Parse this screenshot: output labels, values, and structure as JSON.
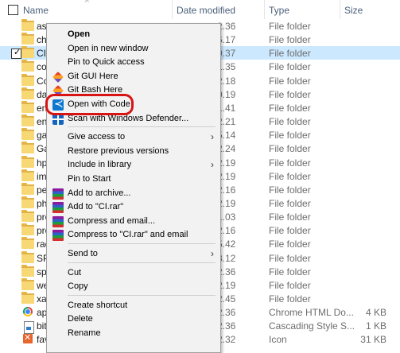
{
  "header": {
    "name": "Name",
    "date_modified": "Date modified",
    "type": "Type",
    "size": "Size"
  },
  "files": [
    {
      "name": "ass",
      "date": "2.36",
      "type": "File folder",
      "size": "",
      "icon": "folder-icon",
      "selected": false
    },
    {
      "name": "cha",
      "date": "6.17",
      "type": "File folder",
      "size": "",
      "icon": "folder-icon",
      "selected": false
    },
    {
      "name": "CI",
      "date": "9.37",
      "type": "File folder",
      "size": "",
      "icon": "folder-icon",
      "selected": true
    },
    {
      "name": "cob",
      "date": "1.35",
      "type": "File folder",
      "size": "",
      "icon": "folder-icon",
      "selected": false
    },
    {
      "name": "Cob",
      "date": "2.18",
      "type": "File folder",
      "size": "",
      "icon": "folder-icon",
      "selected": false
    },
    {
      "name": "das",
      "date": "0.19",
      "type": "File folder",
      "size": "",
      "icon": "folder-icon",
      "selected": false
    },
    {
      "name": "enk",
      "date": "1.41",
      "type": "File folder",
      "size": "",
      "icon": "folder-icon",
      "selected": false
    },
    {
      "name": "ent",
      "date": "2.21",
      "type": "File folder",
      "size": "",
      "icon": "folder-icon",
      "selected": false
    },
    {
      "name": "gar",
      "date": "5.14",
      "type": "File folder",
      "size": "",
      "icon": "folder-icon",
      "selected": false
    },
    {
      "name": "Gar",
      "date": "2.24",
      "type": "File folder",
      "size": "",
      "icon": "folder-icon",
      "selected": false
    },
    {
      "name": "hph",
      "date": "2.19",
      "type": "File folder",
      "size": "",
      "icon": "folder-icon",
      "selected": false
    },
    {
      "name": "img",
      "date": "2.19",
      "type": "File folder",
      "size": "",
      "icon": "folder-icon",
      "selected": false
    },
    {
      "name": "pel",
      "date": "2.16",
      "type": "File folder",
      "size": "",
      "icon": "folder-icon",
      "selected": false
    },
    {
      "name": "php",
      "date": "2.19",
      "type": "File folder",
      "size": "",
      "icon": "folder-icon",
      "selected": false
    },
    {
      "name": "pro",
      "date": "1.03",
      "type": "File folder",
      "size": "",
      "icon": "folder-icon",
      "selected": false
    },
    {
      "name": "pro",
      "date": "2.16",
      "type": "File folder",
      "size": "",
      "icon": "folder-icon",
      "selected": false
    },
    {
      "name": "rac",
      "date": "5.42",
      "type": "File folder",
      "size": "",
      "icon": "folder-icon",
      "selected": false
    },
    {
      "name": "SPK",
      "date": "3.12",
      "type": "File folder",
      "size": "",
      "icon": "folder-icon",
      "selected": false
    },
    {
      "name": "spk",
      "date": "2.36",
      "type": "File folder",
      "size": "",
      "icon": "folder-icon",
      "selected": false
    },
    {
      "name": "wel",
      "date": "2.19",
      "type": "File folder",
      "size": "",
      "icon": "folder-icon",
      "selected": false
    },
    {
      "name": "xan",
      "date": "2.45",
      "type": "File folder",
      "size": "",
      "icon": "folder-icon",
      "selected": false
    },
    {
      "name": "app",
      "date": "2.36",
      "type": "Chrome HTML Do...",
      "size": "4 KB",
      "icon": "chrome-icon",
      "selected": false
    },
    {
      "name": "bitr",
      "date": "2.36",
      "type": "Cascading Style S...",
      "size": "1 KB",
      "icon": "css-file-icon",
      "selected": false
    },
    {
      "name": "favi",
      "date": "2.32",
      "type": "Icon",
      "size": "31 KB",
      "icon": "favicon-icon",
      "selected": false
    }
  ],
  "context_menu": {
    "items": [
      {
        "label": "Open",
        "bold": true,
        "icon": "",
        "submenu": false,
        "sep_before": false
      },
      {
        "label": "Open in new window",
        "bold": false,
        "icon": "",
        "submenu": false,
        "sep_before": false
      },
      {
        "label": "Pin to Quick access",
        "bold": false,
        "icon": "",
        "submenu": false,
        "sep_before": false
      },
      {
        "label": "Git GUI Here",
        "bold": false,
        "icon": "git-icon",
        "submenu": false,
        "sep_before": false
      },
      {
        "label": "Git Bash Here",
        "bold": false,
        "icon": "git-icon",
        "submenu": false,
        "sep_before": false
      },
      {
        "label": "Open with Code",
        "bold": false,
        "icon": "vscode-icon",
        "submenu": false,
        "sep_before": false
      },
      {
        "label": "Scan with Windows Defender...",
        "bold": false,
        "icon": "defender-icon",
        "submenu": false,
        "sep_before": false
      },
      {
        "label": "Give access to",
        "bold": false,
        "icon": "",
        "submenu": true,
        "sep_before": true
      },
      {
        "label": "Restore previous versions",
        "bold": false,
        "icon": "",
        "submenu": false,
        "sep_before": false
      },
      {
        "label": "Include in library",
        "bold": false,
        "icon": "",
        "submenu": true,
        "sep_before": false
      },
      {
        "label": "Pin to Start",
        "bold": false,
        "icon": "",
        "submenu": false,
        "sep_before": false
      },
      {
        "label": "Add to archive...",
        "bold": false,
        "icon": "winrar-icon",
        "submenu": false,
        "sep_before": false
      },
      {
        "label": "Add to \"CI.rar\"",
        "bold": false,
        "icon": "winrar-icon",
        "submenu": false,
        "sep_before": false
      },
      {
        "label": "Compress and email...",
        "bold": false,
        "icon": "winrar-icon",
        "submenu": false,
        "sep_before": false
      },
      {
        "label": "Compress to \"CI.rar\" and email",
        "bold": false,
        "icon": "winrar-icon",
        "submenu": false,
        "sep_before": false
      },
      {
        "label": "Send to",
        "bold": false,
        "icon": "",
        "submenu": true,
        "sep_before": true
      },
      {
        "label": "Cut",
        "bold": false,
        "icon": "",
        "submenu": false,
        "sep_before": true
      },
      {
        "label": "Copy",
        "bold": false,
        "icon": "",
        "submenu": false,
        "sep_before": false
      },
      {
        "label": "Create shortcut",
        "bold": false,
        "icon": "",
        "submenu": false,
        "sep_before": true
      },
      {
        "label": "Delete",
        "bold": false,
        "icon": "",
        "submenu": false,
        "sep_before": false
      },
      {
        "label": "Rename",
        "bold": false,
        "icon": "",
        "submenu": false,
        "sep_before": false
      }
    ],
    "highlight_color": "#d81414"
  },
  "colors": {
    "selection": "#cce8ff",
    "folder": "#f8d775",
    "header_text": "#4c607a"
  }
}
